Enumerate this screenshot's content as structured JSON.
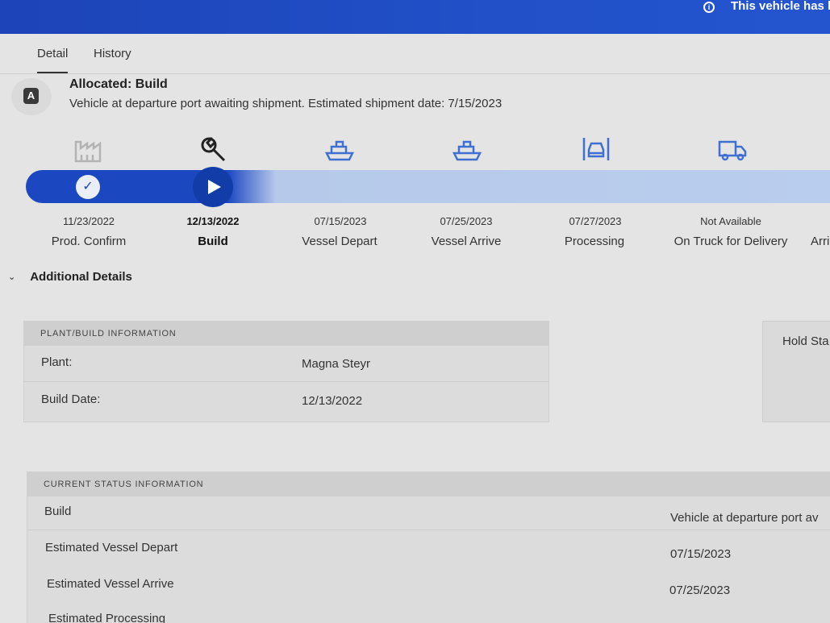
{
  "banner": {
    "notice_text": "This vehicle has l"
  },
  "tabs": [
    {
      "label": "Detail",
      "active": true
    },
    {
      "label": "History",
      "active": false
    }
  ],
  "allocation": {
    "badge_letter": "A",
    "title": "Allocated: Build",
    "description": "Vehicle at departure port awaiting shipment. Estimated shipment date: 7/15/2023"
  },
  "steps": [
    {
      "icon": "factory-icon",
      "date": "11/23/2022",
      "label": "Prod. Confirm",
      "status": "complete"
    },
    {
      "icon": "wrench-icon",
      "date": "12/13/2022",
      "label": "Build",
      "status": "current"
    },
    {
      "icon": "ship-icon",
      "date": "07/15/2023",
      "label": "Vessel Depart",
      "status": "pending"
    },
    {
      "icon": "ship-icon",
      "date": "07/25/2023",
      "label": "Vessel Arrive",
      "status": "pending"
    },
    {
      "icon": "processing-icon",
      "date": "07/27/2023",
      "label": "Processing",
      "status": "pending"
    },
    {
      "icon": "truck-icon",
      "date": "Not Available",
      "label": "On Truck for Delivery",
      "status": "pending"
    },
    {
      "icon": "",
      "date": "",
      "label": "Arri",
      "status": "pending"
    }
  ],
  "additional_details": {
    "label": "Additional Details"
  },
  "plant_info": {
    "header": "PLANT/BUILD INFORMATION",
    "rows": [
      {
        "label": "Plant:",
        "value": "Magna Steyr"
      },
      {
        "label": "Build Date:",
        "value": "12/13/2022"
      }
    ]
  },
  "hold_status": {
    "label": "Hold Sta"
  },
  "current_status": {
    "header": "CURRENT STATUS INFORMATION",
    "rows": [
      {
        "label": "Build",
        "value": "Vehicle at departure port av"
      },
      {
        "label": "Estimated Vessel Depart",
        "value": "07/15/2023"
      },
      {
        "label": "Estimated Vessel Arrive",
        "value": "07/25/2023"
      },
      {
        "label": "Estimated Processing",
        "value": ""
      }
    ]
  },
  "colors": {
    "brand_blue": "#1b47c0",
    "progress_light": "#b9cdee",
    "icon_blue": "#3f6fd0"
  }
}
